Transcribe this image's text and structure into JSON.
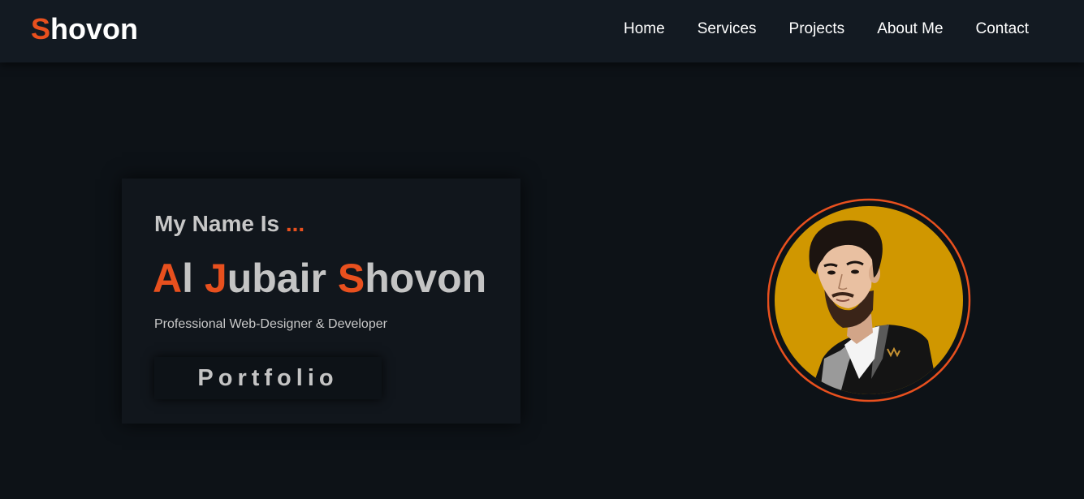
{
  "nav": {
    "logo_first": "S",
    "logo_rest": "hovon",
    "links": [
      "Home",
      "Services",
      "Projects",
      "About Me",
      "Contact"
    ]
  },
  "hero": {
    "intro_text": "My Name Is ",
    "intro_dots": "...",
    "name_parts": [
      {
        "text": "A",
        "accent": true
      },
      {
        "text": "l ",
        "accent": false
      },
      {
        "text": "J",
        "accent": true
      },
      {
        "text": "ubair ",
        "accent": false
      },
      {
        "text": "S",
        "accent": true
      },
      {
        "text": "hovon",
        "accent": false
      }
    ],
    "tagline": "Professional Web-Designer & Developer",
    "button_label": "Portfolio"
  },
  "colors": {
    "accent": "#e8501e",
    "background": "#0d1217",
    "navbar": "#131a22",
    "card": "#11161c",
    "avatar_bg": "#d09700"
  }
}
